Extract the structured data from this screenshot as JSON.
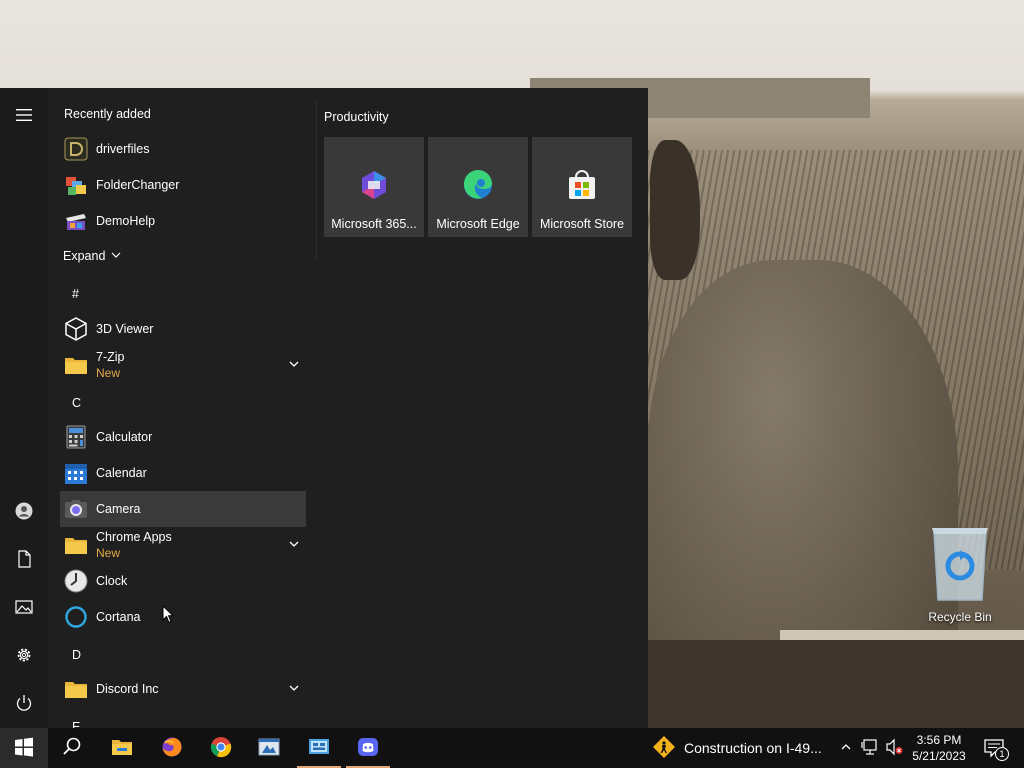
{
  "desktop": {
    "icons": [
      {
        "label": "Recycle Bin",
        "icon": "recycle-bin-icon"
      }
    ]
  },
  "start_menu": {
    "rail": [
      {
        "name": "hamburger-menu",
        "icon": "hamburger-icon"
      },
      {
        "name": "account",
        "icon": "user-icon"
      },
      {
        "name": "documents",
        "icon": "document-icon"
      },
      {
        "name": "pictures",
        "icon": "pictures-icon"
      },
      {
        "name": "settings",
        "icon": "gear-icon"
      },
      {
        "name": "power",
        "icon": "power-icon"
      }
    ],
    "recently_added_label": "Recently added",
    "recent": [
      {
        "label": "driverfiles",
        "icon": "driverfiles-icon"
      },
      {
        "label": "FolderChanger",
        "icon": "folderchanger-icon"
      },
      {
        "label": "DemoHelp",
        "icon": "demohelp-icon"
      }
    ],
    "expand_label": "Expand",
    "letters": {
      "hash": "#",
      "c": "C",
      "d": "D",
      "e": "E"
    },
    "apps": [
      {
        "label": "3D Viewer",
        "icon": "cube-icon"
      },
      {
        "label": "7-Zip",
        "badge": "New",
        "icon": "folder-icon",
        "expandable": true
      },
      {
        "label": "Calculator",
        "icon": "calculator-icon"
      },
      {
        "label": "Calendar",
        "icon": "calendar-icon"
      },
      {
        "label": "Camera",
        "icon": "camera-icon",
        "selected": true
      },
      {
        "label": "Chrome Apps",
        "badge": "New",
        "icon": "folder-icon",
        "expandable": true
      },
      {
        "label": "Clock",
        "icon": "clock-icon"
      },
      {
        "label": "Cortana",
        "icon": "cortana-icon"
      },
      {
        "label": "Discord Inc",
        "icon": "folder-icon",
        "expandable": true
      }
    ],
    "tiles_group": "Productivity",
    "tiles": [
      {
        "label": "Microsoft 365...",
        "icon": "microsoft-365-icon"
      },
      {
        "label": "Microsoft Edge",
        "icon": "edge-icon"
      },
      {
        "label": "Microsoft Store",
        "icon": "store-icon"
      }
    ]
  },
  "taskbar": {
    "pinned": [
      {
        "name": "start",
        "icon": "windows-icon"
      },
      {
        "name": "search",
        "icon": "search-icon"
      },
      {
        "name": "file-explorer",
        "icon": "folder-icon"
      },
      {
        "name": "firefox",
        "icon": "firefox-icon"
      },
      {
        "name": "chrome",
        "icon": "chrome-icon"
      },
      {
        "name": "app-window",
        "icon": "app-window-icon"
      },
      {
        "name": "control-panel",
        "icon": "control-panel-icon",
        "running": true
      },
      {
        "name": "discord",
        "icon": "discord-icon",
        "running": true
      }
    ],
    "news": "Construction on I-49...",
    "clock": {
      "time": "3:56 PM",
      "date": "5/21/2023"
    },
    "notification_count": "1",
    "accent": "#e3a778"
  }
}
